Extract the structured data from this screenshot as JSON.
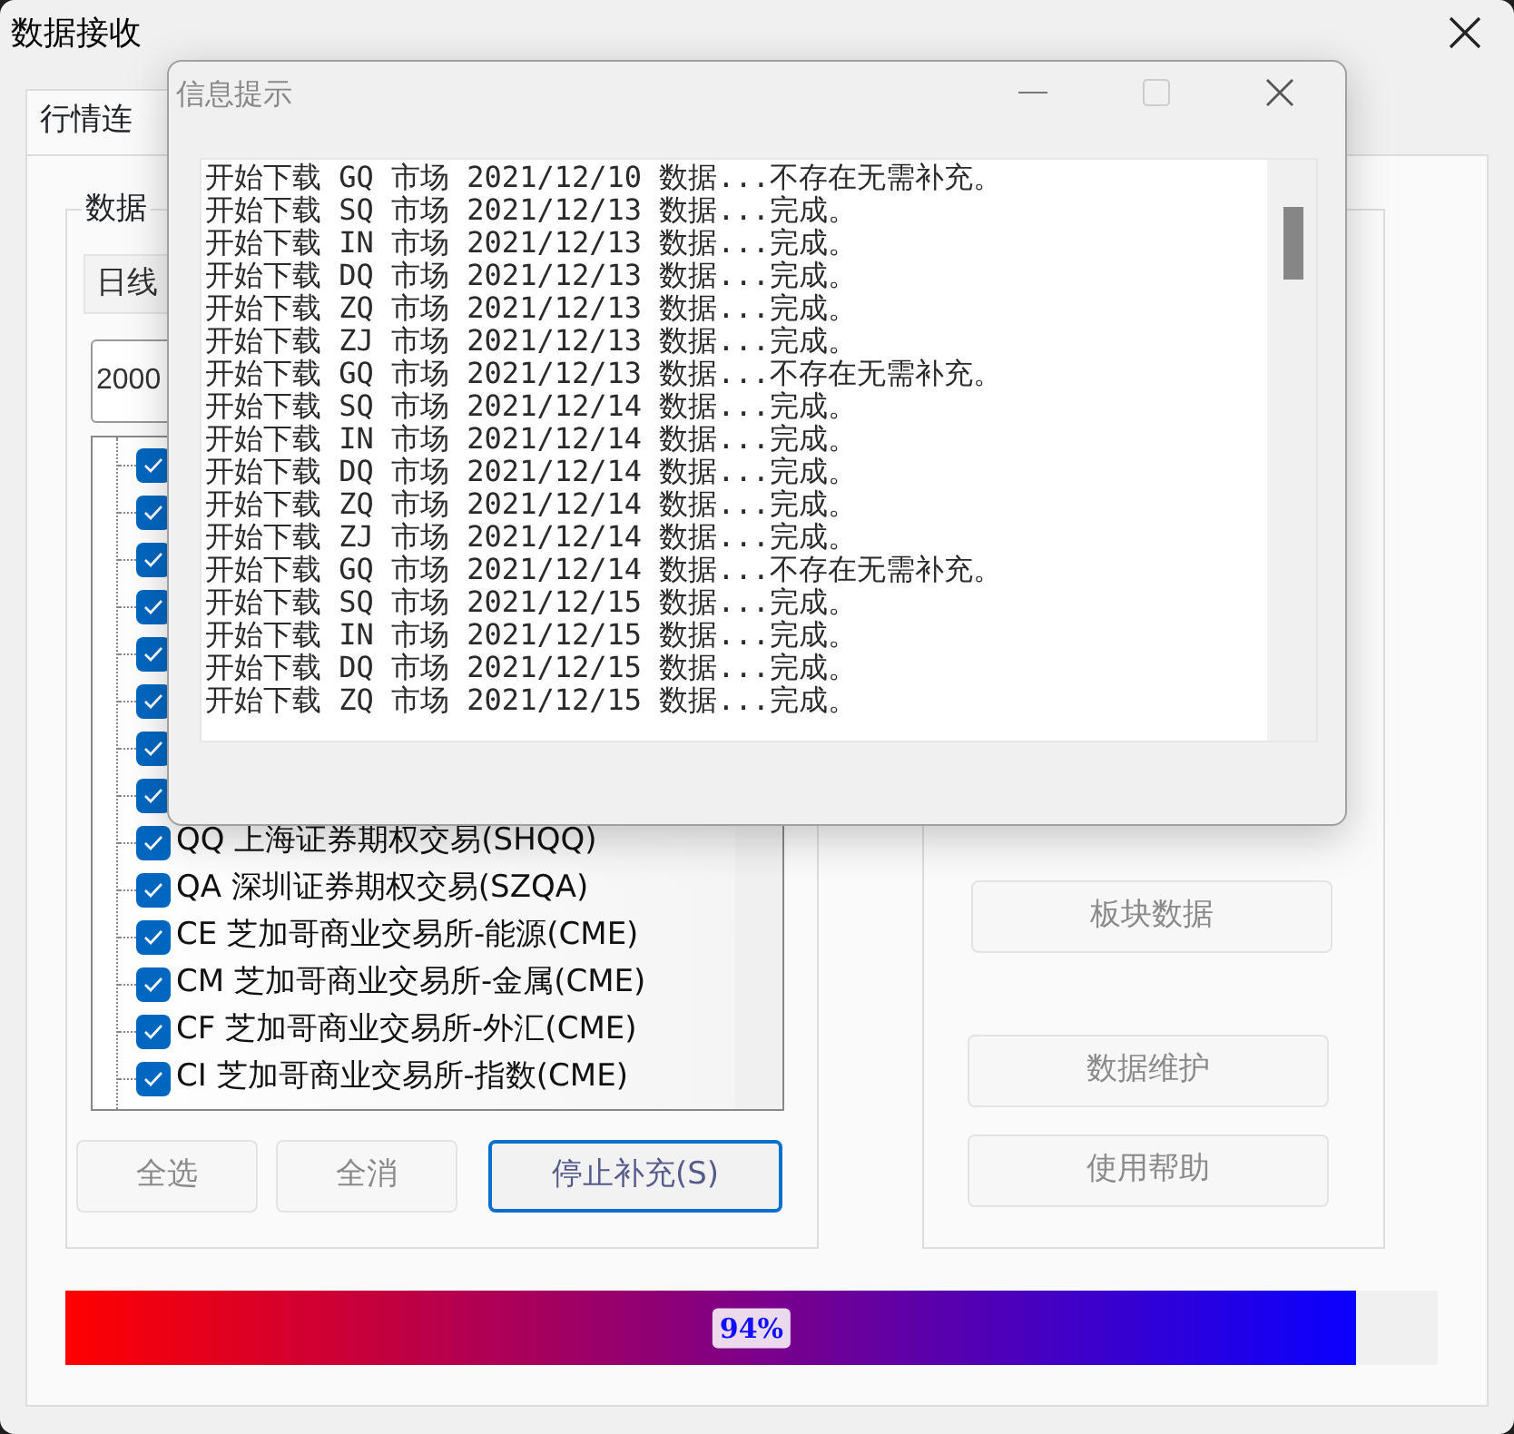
{
  "window": {
    "title": "数据接收"
  },
  "tabs": [
    {
      "label": "行情连",
      "selected": true
    }
  ],
  "data_group": {
    "legend": "数据",
    "period": "日线",
    "start_date": "2000"
  },
  "market_tree": {
    "items": [
      {
        "checked": true
      },
      {
        "checked": true
      },
      {
        "checked": true
      },
      {
        "checked": true
      },
      {
        "checked": true
      },
      {
        "checked": true
      },
      {
        "checked": true
      },
      {
        "checked": true
      },
      {
        "label": "QQ 上海证券期权交易(SHQQ)",
        "checked": true
      },
      {
        "label": "QA 深圳证券期权交易(SZQA)",
        "checked": true
      },
      {
        "label": "CE 芝加哥商业交易所-能源(CME)",
        "checked": true
      },
      {
        "label": "CM 芝加哥商业交易所-金属(CME)",
        "checked": true
      },
      {
        "label": "CF 芝加哥商业交易所-外汇(CME)",
        "checked": true
      },
      {
        "label": "CI 芝加哥商业交易所-指数(CME)",
        "checked": true
      }
    ]
  },
  "left_buttons": [
    {
      "label": "全选",
      "disabled": true,
      "focused": false
    },
    {
      "label": "全消",
      "disabled": true,
      "focused": false
    },
    {
      "label": "停止补充(S)",
      "disabled": false,
      "focused": true
    }
  ],
  "right_buttons": [
    {
      "label": "板块数据",
      "disabled": true
    },
    {
      "label": "数据维护",
      "disabled": true
    },
    {
      "label": "使用帮助",
      "disabled": true
    }
  ],
  "progress": {
    "level": 0.94,
    "label": "94%"
  },
  "dialog": {
    "title": "信息提示",
    "log": [
      "开始下载 GQ 市场 2021/12/10 数据...不存在无需补充。",
      "开始下载 SQ 市场 2021/12/13 数据...完成。",
      "开始下载 IN 市场 2021/12/13 数据...完成。",
      "开始下载 DQ 市场 2021/12/13 数据...完成。",
      "开始下载 ZQ 市场 2021/12/13 数据...完成。",
      "开始下载 ZJ 市场 2021/12/13 数据...完成。",
      "开始下载 GQ 市场 2021/12/13 数据...不存在无需补充。",
      "开始下载 SQ 市场 2021/12/14 数据...完成。",
      "开始下载 IN 市场 2021/12/14 数据...完成。",
      "开始下载 DQ 市场 2021/12/14 数据...完成。",
      "开始下载 ZQ 市场 2021/12/14 数据...完成。",
      "开始下载 ZJ 市场 2021/12/14 数据...完成。",
      "开始下载 GQ 市场 2021/12/14 数据...不存在无需补充。",
      "开始下载 SQ 市场 2021/12/15 数据...完成。",
      "开始下载 IN 市场 2021/12/15 数据...完成。",
      "开始下载 DQ 市场 2021/12/15 数据...完成。",
      "开始下载 ZQ 市场 2021/12/15 数据...完成。"
    ]
  }
}
